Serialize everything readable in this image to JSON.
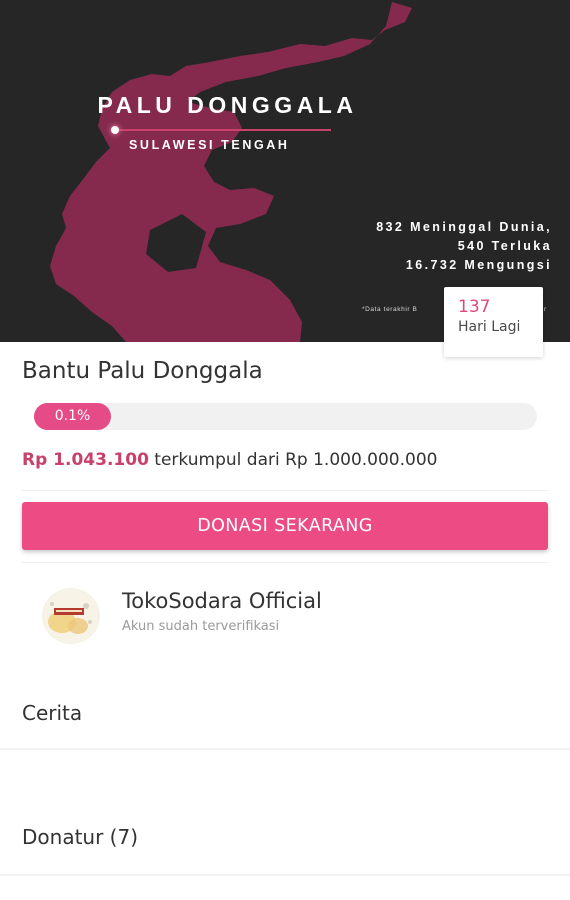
{
  "hero": {
    "title": "PALU DONGGALA",
    "subtitle": "SULAWESI TENGAH",
    "stats": [
      "832 Meninggal Dunia,",
      "540 Terluka",
      "16.732 Mengungsi"
    ],
    "footnote": "*Data terakhir B",
    "footnote_tail": "r"
  },
  "days_left": {
    "number": "137",
    "label": "Hari Lagi"
  },
  "campaign": {
    "title": "Bantu Palu Donggala",
    "progress": {
      "percent_label": "0.1%",
      "fraction": 0.001
    },
    "raised_amount": "Rp 1.043.100",
    "raised_text": " terkumpul dari Rp 1.000.000.000",
    "donate_label": "DONASI SEKARANG"
  },
  "organizer": {
    "name": "TokoSodara Official",
    "status": "Akun sudah terverifikasi",
    "avatar_icon": "organizer-logo-icon"
  },
  "sections": {
    "story": "Cerita",
    "donors": "Donatur (7)"
  },
  "colors": {
    "accent": "#ec4b84",
    "accent_text": "#c7416b",
    "hero_bg": "#262626",
    "map_fill": "#8b2a4f"
  }
}
